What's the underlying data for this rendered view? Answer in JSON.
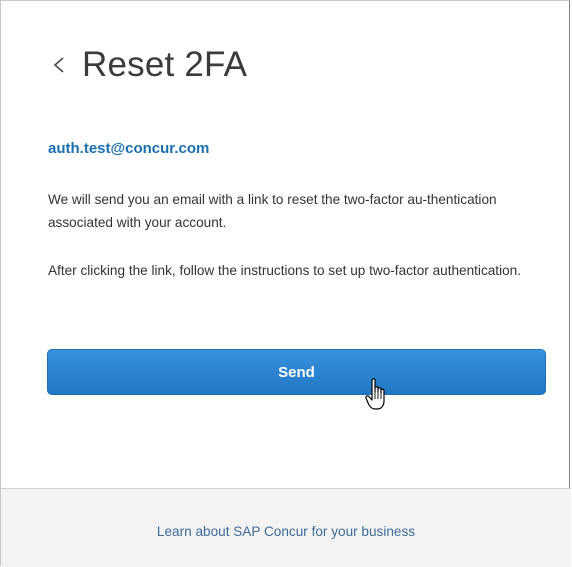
{
  "page": {
    "title": "Reset 2FA",
    "back_icon": "chevron-left-icon"
  },
  "account": {
    "email": "auth.test@concur.com"
  },
  "instructions": {
    "paragraph1": "We will send you an email with a link to reset the two-factor au-thentication associated with your account.",
    "paragraph2": "After clicking the link, follow the instructions to set up two-factor authentication."
  },
  "actions": {
    "send_label": "Send"
  },
  "footer": {
    "link_text": "Learn about SAP Concur for your business"
  },
  "colors": {
    "accent": "#2a7fcc",
    "email_text": "#1a6fb0",
    "footer_bg": "#f3f3f3"
  },
  "cursor": "hand-pointer-icon"
}
